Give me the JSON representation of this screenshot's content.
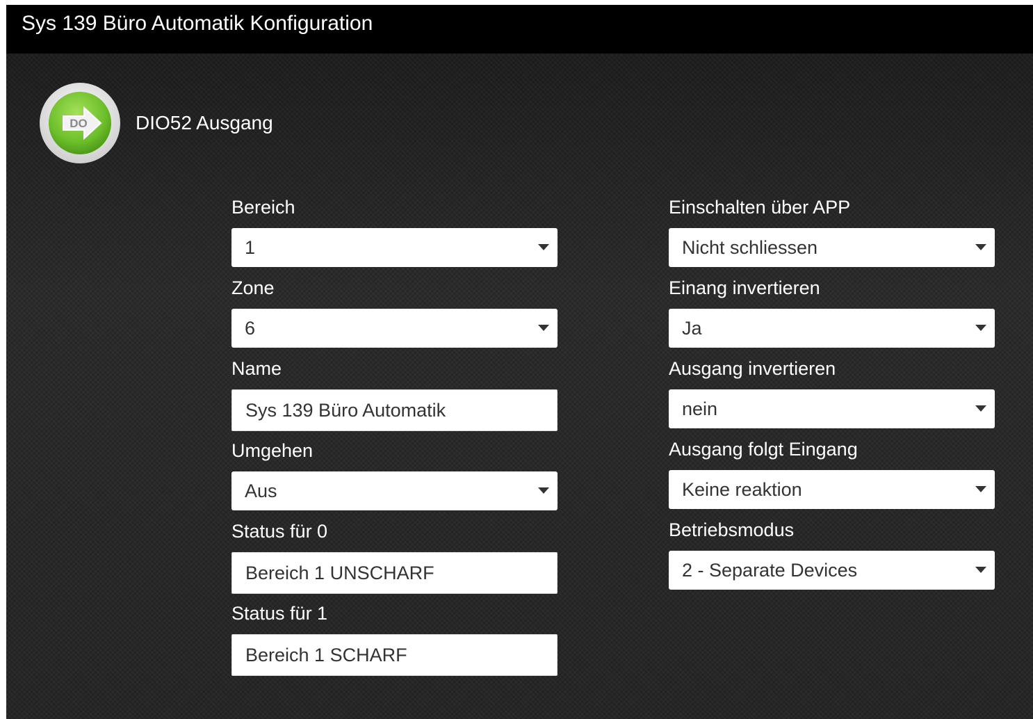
{
  "window": {
    "title": "Sys 139 Büro Automatik Konfiguration"
  },
  "device": {
    "icon": "do-output-arrow-icon",
    "icon_text": "DO",
    "name": "DIO52 Ausgang"
  },
  "colors": {
    "accent_green": "#6cbf2a",
    "background": "#262626",
    "titlebar": "#000000"
  },
  "left": {
    "bereich": {
      "label": "Bereich",
      "value": "1"
    },
    "zone": {
      "label": "Zone",
      "value": "6"
    },
    "name": {
      "label": "Name",
      "value": "Sys 139 Büro Automatik"
    },
    "umgehen": {
      "label": "Umgehen",
      "value": "Aus"
    },
    "status0": {
      "label": "Status für 0",
      "value": "Bereich 1 UNSCHARF"
    },
    "status1": {
      "label": "Status für 1",
      "value": "Bereich 1 SCHARF"
    }
  },
  "right": {
    "einschalten": {
      "label": "Einschalten über APP",
      "value": "Nicht schliessen"
    },
    "eingang_inv": {
      "label": "Einang invertieren",
      "value": "Ja"
    },
    "ausgang_inv": {
      "label": "Ausgang invertieren",
      "value": "nein"
    },
    "folgt": {
      "label": "Ausgang folgt Eingang",
      "value": "Keine reaktion"
    },
    "modus": {
      "label": "Betriebsmodus",
      "value": "2 - Separate Devices"
    }
  }
}
